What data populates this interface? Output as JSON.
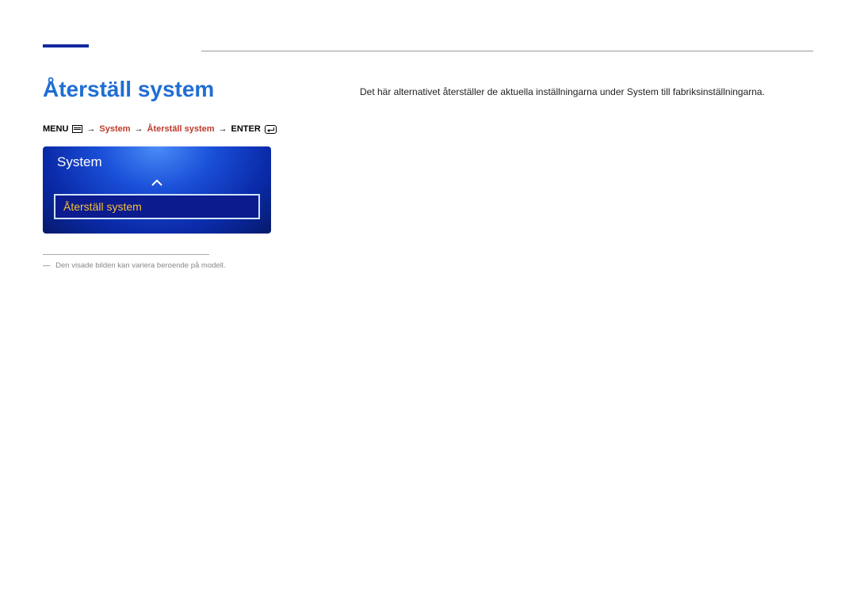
{
  "page_title": "Återställ system",
  "breadcrumb": {
    "menu_label": "MENU",
    "arrow": "→",
    "item1": "System",
    "item2": "Återställ system",
    "enter_label": "ENTER"
  },
  "osd": {
    "header": "System",
    "selected_item": "Återställ system"
  },
  "footnote": {
    "dash": "―",
    "text": "Den visade bilden kan variera beroende på modell."
  },
  "description": "Det här alternativet återställer de aktuella inställningarna under System till fabriksinställningarna."
}
